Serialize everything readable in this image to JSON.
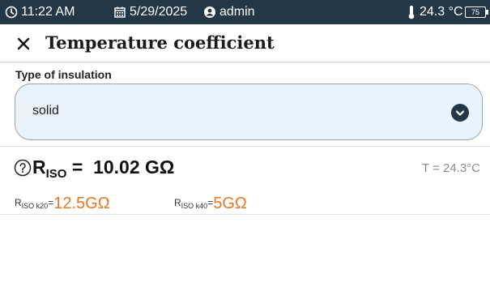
{
  "statusbar": {
    "time": "11:22 AM",
    "date": "5/29/2025",
    "user": "admin",
    "temperature": "24.3 °C",
    "battery": "75"
  },
  "header": {
    "title": "Temperature coefficient"
  },
  "insulation": {
    "label": "Type of insulation",
    "selected": "solid"
  },
  "result": {
    "riso_symbol": "R",
    "riso_sub": "ISO",
    "riso_eq": " =",
    "riso_value": "10.02 GΩ",
    "temperature": "T = 24.3°C",
    "k20_symbol": "R",
    "k20_sub": "ISO k20",
    "k20_eq": "=",
    "k20_value": "12.5GΩ",
    "k40_symbol": "R",
    "k40_sub": "ISO k40",
    "k40_eq": "=",
    "k40_value": "5GΩ"
  },
  "colors": {
    "statusbar_bg": "#243746",
    "field_bg": "#e8f3fb",
    "accent_orange": "#e87722"
  }
}
